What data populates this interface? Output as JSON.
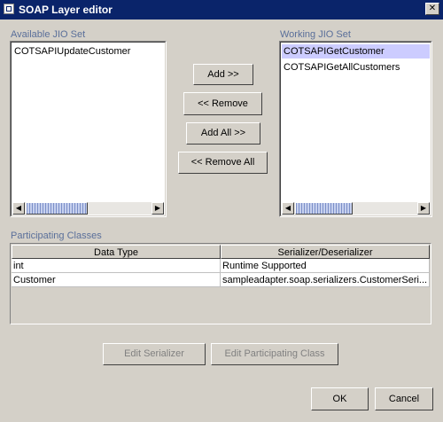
{
  "window": {
    "title": "SOAP Layer editor",
    "close_glyph": "✕"
  },
  "available": {
    "label": "Available JIO Set",
    "items": [
      "COTSAPIUpdateCustomer"
    ]
  },
  "working": {
    "label": "Working JIO Set",
    "items": [
      "COTSAPIGetCustomer",
      "COTSAPIGetAllCustomers"
    ],
    "selected_index": 0
  },
  "transfer_buttons": {
    "add": "Add >>",
    "remove": "<< Remove",
    "add_all": "Add All >>",
    "remove_all": "<< Remove All"
  },
  "participating": {
    "label": "Participating Classes",
    "columns": [
      "Data Type",
      "Serializer/Deserializer"
    ],
    "rows": [
      [
        "int",
        "Runtime Supported"
      ],
      [
        "Customer",
        "sampleadapter.soap.serializers.CustomerSeri..."
      ]
    ]
  },
  "action_buttons": {
    "edit_serializer": "Edit Serializer",
    "edit_participating_class": "Edit Participating Class"
  },
  "dialog_buttons": {
    "ok": "OK",
    "cancel": "Cancel"
  },
  "icons": {
    "scroll_left": "◀",
    "scroll_right": "▶"
  },
  "colors": {
    "titlebar": "#0a246a",
    "group_label": "#5a6f9a",
    "selection": "#ccccff",
    "window_bg": "#d4d0c8"
  }
}
